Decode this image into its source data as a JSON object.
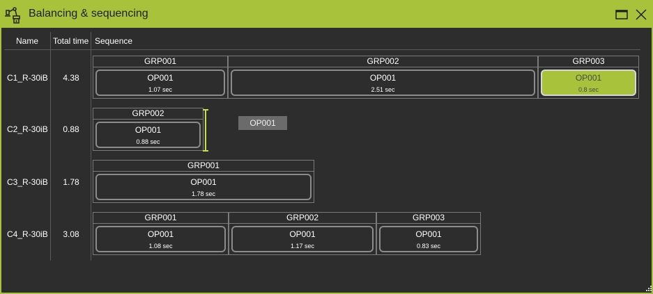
{
  "window": {
    "title": "Balancing & sequencing",
    "icon": "robot-arm-icon",
    "accent_color": "#a9c23c",
    "background_color": "#2d2d2d"
  },
  "table": {
    "columns": [
      "Name",
      "Total time",
      "Sequence"
    ]
  },
  "rows": [
    {
      "name": "C1_R-30iB",
      "total_time": "4.38",
      "groups": [
        {
          "label": "GRP001",
          "op": "OP001",
          "time": "1.07 sec",
          "selected": false
        },
        {
          "label": "GRP002",
          "op": "OP001",
          "time": "2.51 sec",
          "selected": false
        },
        {
          "label": "GRP003",
          "op": "OP001",
          "time": "0.8 sec",
          "selected": true
        }
      ]
    },
    {
      "name": "C2_R-30iB",
      "total_time": "0.88",
      "groups": [
        {
          "label": "GRP002",
          "op": "OP001",
          "time": "0.88 sec",
          "selected": false
        }
      ]
    },
    {
      "name": "C3_R-30iB",
      "total_time": "1.78",
      "groups": [
        {
          "label": "GRP001",
          "op": "OP001",
          "time": "1.78 sec",
          "selected": false
        }
      ]
    },
    {
      "name": "C4_R-30iB",
      "total_time": "3.08",
      "groups": [
        {
          "label": "GRP001",
          "op": "OP001",
          "time": "1.08 sec",
          "selected": false
        },
        {
          "label": "GRP002",
          "op": "OP001",
          "time": "1.17 sec",
          "selected": false
        },
        {
          "label": "GRP003",
          "op": "OP001",
          "time": "0.83 sec",
          "selected": false
        }
      ]
    }
  ],
  "drag": {
    "label": "OP001"
  }
}
